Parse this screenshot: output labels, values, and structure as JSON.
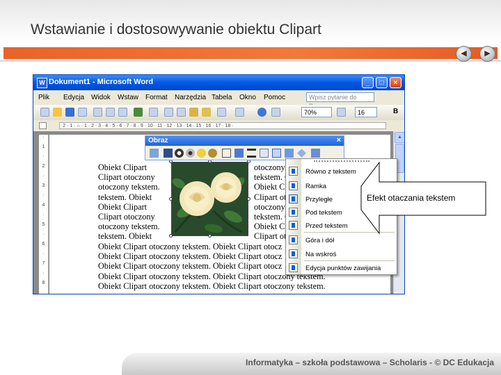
{
  "slide": {
    "title": "Wstawianie i dostosowywanie obiektu Clipart",
    "footer": "Informatyka – szkoła podstawowa – Scholaris - © DC Edukacja",
    "nav_prev": "◀",
    "nav_next": "▶"
  },
  "word": {
    "window_title": "Dokument1 - Microsoft Word",
    "title_icon": "W",
    "window_buttons": [
      "_",
      "□",
      "×"
    ],
    "menu": [
      "Plik",
      "Edycja",
      "Widok",
      "Wstaw",
      "Format",
      "Narzędzia",
      "Tabela",
      "Okno",
      "Pomoc"
    ],
    "help_placeholder": "Wpisz pytanie do Pomocy",
    "zoom": "70%",
    "font_size": "16",
    "ruler_marks": "· 2 · 1 · ⌂ · 1 · 2 · 3 · 4 · 5 · 6 · 7 · 8 · 9 · 10 · 11 · 12 · 13 · 14 · 15 · 16 · 17 · 18 ·",
    "vruler_marks": [
      "·",
      "1",
      "·",
      "2",
      "·",
      "3",
      "·",
      "4",
      "·",
      "5",
      "·",
      "6",
      "·",
      "7",
      "·",
      "8"
    ]
  },
  "document": {
    "left_col": [
      "Obiekt Clipart",
      "Clipart otoczony",
      "otoczony tekstem.",
      "tekstem. Obiekt",
      "Obiekt Clipart",
      "Clipart otoczony",
      "otoczony tekstem.",
      "tekstem. Obiekt"
    ],
    "right_col": [
      "otoczony t",
      "tekstem. O",
      "Obiekt Cl",
      "Clipart ot",
      "otoczony",
      "tekstem. O",
      "Obiekt Cli",
      "Clipart ot"
    ],
    "full_lines": [
      "Obiekt Clipart otoczony tekstem. Obiekt Clipart otocz",
      "Obiekt Clipart otoczony tekstem. Obiekt Clipart otocz",
      "Obiekt Clipart otoczony tekstem. Obiekt Clipart otocz",
      "Obiekt Clipart otoczony tekstem. Obiekt Clipart otoczony tekstem.",
      "Obiekt Clipart otoczony tekstem. Obiekt Clipart otoczony tekstem."
    ]
  },
  "picture_toolbar": {
    "title": "Obraz",
    "close": "×"
  },
  "wrap_menu": {
    "items": [
      {
        "label": "Równo z tekstem",
        "selected": false
      },
      {
        "label": "Ramka",
        "selected": false
      },
      {
        "label": "Przyległe",
        "selected": true
      },
      {
        "label": "Pod tekstem",
        "selected": false
      },
      {
        "label": "Przed tekstem",
        "selected": false
      },
      {
        "label": "Góra i dół",
        "selected": false
      },
      {
        "label": "Na wskroś",
        "selected": false
      },
      {
        "label": "Edycja punktów zawijania",
        "selected": false
      }
    ]
  },
  "callout": {
    "text": "Efekt otaczania tekstem"
  },
  "colors": {
    "accent_orange": "#e8632a",
    "xp_title_blue": "#0058e6"
  }
}
